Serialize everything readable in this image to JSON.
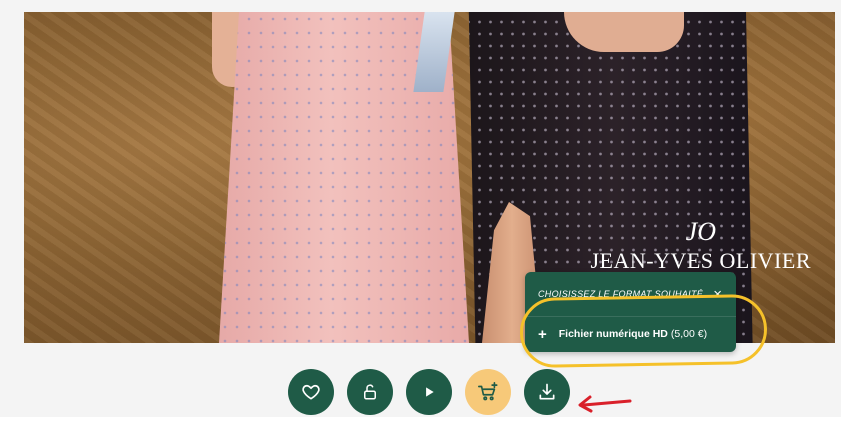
{
  "photo": {
    "watermark": {
      "monogram": "JO",
      "name": "JEAN-YVES OLIVIER"
    }
  },
  "format_popup": {
    "title": "CHOISISSEZ LE FORMAT SOUHAITÉ",
    "close_symbol": "×",
    "option": {
      "plus_symbol": "+",
      "label": "Fichier numérique HD",
      "price": "(5,00 €)"
    }
  },
  "toolbar": {
    "buttons": [
      {
        "name": "favorite",
        "icon": "heart-icon"
      },
      {
        "name": "unlock",
        "icon": "unlock-icon"
      },
      {
        "name": "slideshow",
        "icon": "play-icon"
      },
      {
        "name": "add-to-cart",
        "icon": "cart-plus-icon"
      },
      {
        "name": "download",
        "icon": "download-icon"
      }
    ]
  },
  "colors": {
    "primary": "#1f5b47",
    "cart_button": "#f7c979",
    "highlight": "#f5c12a",
    "arrow": "#d9202a"
  }
}
